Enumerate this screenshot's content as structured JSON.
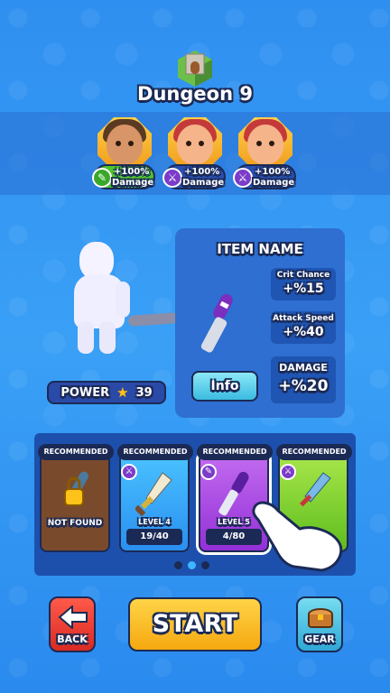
{
  "level": {
    "title": "Dungeon 9"
  },
  "heroes": [
    {
      "bonus": "+100%",
      "label": "Damage",
      "icon": "wrench-icon",
      "color": "#4fc431"
    },
    {
      "bonus": "+100%",
      "label": "Damage",
      "icon": "sword-icon",
      "color": "#2a4fb0"
    },
    {
      "bonus": "+100%",
      "label": "Damage",
      "icon": "sword-icon",
      "color": "#2a4fb0"
    }
  ],
  "player": {
    "power_label": "POWER",
    "power_value": "39"
  },
  "item": {
    "name": "ITEM NAME",
    "crit_label": "Crit Chance",
    "crit_value": "+%15",
    "speed_label": "Attack Speed",
    "speed_value": "+%40",
    "damage_label": "DAMAGE",
    "damage_value": "+%20",
    "info_label": "Info"
  },
  "cards": [
    {
      "badge": "RECOMMENDED",
      "status": "NOT FOUND",
      "type": "locked"
    },
    {
      "badge": "RECOMMENDED",
      "level": "LEVEL 4",
      "progress": "19/40",
      "type": "blue"
    },
    {
      "badge": "RECOMMENDED",
      "level": "LEVEL 5",
      "progress": "4/80",
      "type": "purple"
    },
    {
      "badge": "RECOMMENDED",
      "type": "green"
    }
  ],
  "buttons": {
    "back": "BACK",
    "start": "START",
    "gear": "GEAR"
  },
  "pagination": {
    "pages": 3,
    "current": 2
  }
}
